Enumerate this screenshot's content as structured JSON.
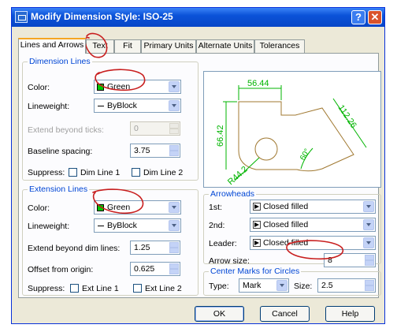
{
  "window": {
    "title": "Modify Dimension Style: ISO-25",
    "help_label": "?",
    "close_label": "✕"
  },
  "tabs": [
    "Lines and Arrows",
    "Text",
    "Fit",
    "Primary Units",
    "Alternate Units",
    "Tolerances"
  ],
  "dimension_lines": {
    "caption": "Dimension Lines",
    "color_label": "Color:",
    "color_value": "Green",
    "lineweight_label": "Lineweight:",
    "lineweight_value": "ByBlock",
    "extend_label": "Extend beyond ticks:",
    "extend_value": "0",
    "baseline_label": "Baseline spacing:",
    "baseline_value": "3.75",
    "suppress_label": "Suppress:",
    "dim1_label": "Dim Line 1",
    "dim2_label": "Dim Line 2"
  },
  "extension_lines": {
    "caption": "Extension Lines",
    "color_label": "Color:",
    "color_value": "Green",
    "lineweight_label": "Lineweight:",
    "lineweight_value": "ByBlock",
    "extend_label": "Extend beyond dim lines:",
    "extend_value": "1.25",
    "offset_label": "Offset from origin:",
    "offset_value": "0.625",
    "suppress_label": "Suppress:",
    "ext1_label": "Ext Line 1",
    "ext2_label": "Ext Line 2"
  },
  "preview": {
    "dim_top": "56.44",
    "dim_left": "66.42",
    "dim_right": "112.26",
    "dim_bottom": "R44.2",
    "dim_angle": "60°"
  },
  "arrowheads": {
    "caption": "Arrowheads",
    "first_label": "1st:",
    "first_value": "Closed filled",
    "second_label": "2nd:",
    "second_value": "Closed filled",
    "leader_label": "Leader:",
    "leader_value": "Closed filled",
    "size_label": "Arrow size:",
    "size_value": "8"
  },
  "center_marks": {
    "caption": "Center Marks for Circles",
    "type_label": "Type:",
    "type_value": "Mark",
    "size_label": "Size:",
    "size_value": "2.5"
  },
  "buttons": {
    "ok": "OK",
    "cancel": "Cancel",
    "help": "Help"
  },
  "colors": {
    "titlebar": "#0a52d8",
    "dialog_bg": "#ece9d8",
    "preview_green": "#00b400",
    "preview_brown": "#a07830",
    "annotation_red": "#c81e1e",
    "swatch_green": "#00c800"
  },
  "icons": [
    "app-icon",
    "help-icon",
    "close-icon",
    "chevron-down-icon",
    "closed-filled-arrow-icon",
    "spinner-icon"
  ]
}
